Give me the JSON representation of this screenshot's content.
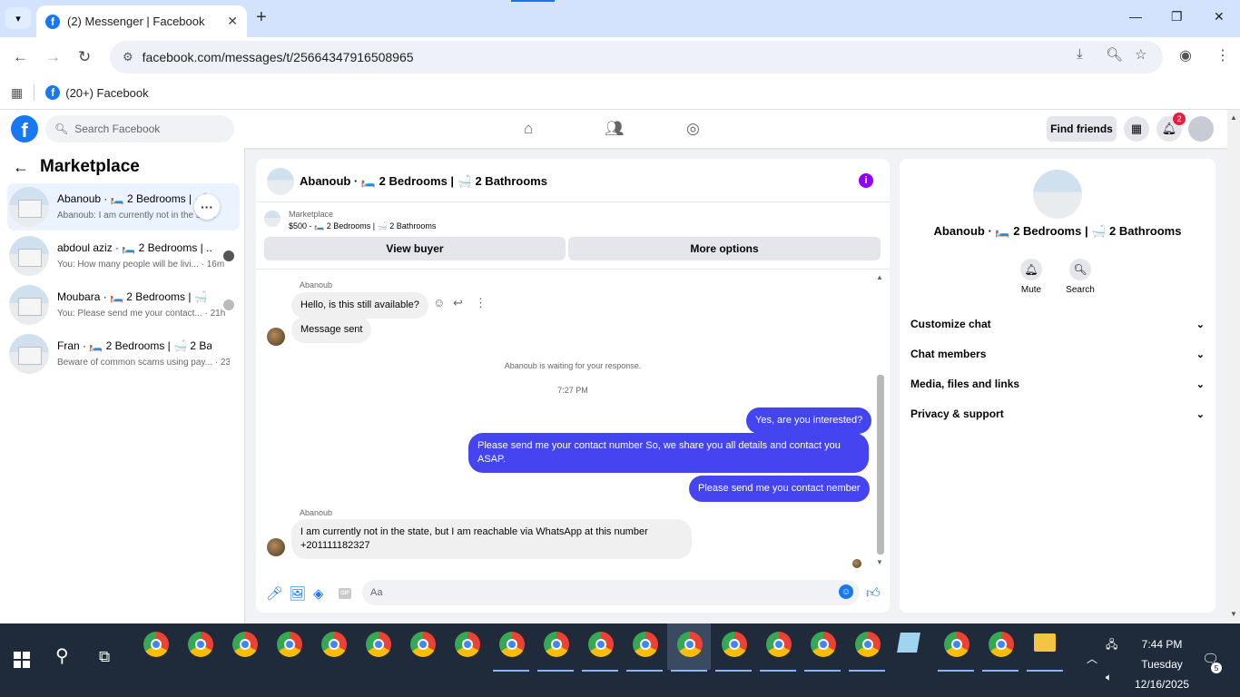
{
  "browser": {
    "tab_title": "(2) Messenger | Facebook",
    "url": "facebook.com/messages/t/25664347916508965",
    "bookmark_label": "(20+) Facebook"
  },
  "fb_header": {
    "search_placeholder": "Search Facebook",
    "find_friends_label": "Find friends",
    "notification_count": "2"
  },
  "sidebar": {
    "title": "Marketplace",
    "conversations": [
      {
        "name": "Abanoub · 🛏️ 2 Bedrooms | 🛁 2 B...",
        "snippet": "Abanoub: I am currently not in the state",
        "active": true
      },
      {
        "name": "abdoul aziz · 🛏️ 2 Bedrooms | ...",
        "snippet": "You: How many people will be livi... · 16m",
        "active": false
      },
      {
        "name": "Moubara · 🛏️ 2 Bedrooms | 🛁 ...",
        "snippet": "You: Please send me your contact... · 21h",
        "active": false
      },
      {
        "name": "Fran · 🛏️ 2 Bedrooms | 🛁 2 Bathr...",
        "snippet": "Beware of common scams using pay... · 23h",
        "active": false
      }
    ]
  },
  "chat": {
    "title": "Abanoub · 🛏️ 2 Bedrooms | 🛁 2 Bathrooms",
    "listing_category": "Marketplace",
    "listing_price": "$500 - 🛏️ 2 Bedrooms | 🛁 2 Bathrooms",
    "view_buyer_label": "View buyer",
    "more_options_label": "More options",
    "messages": {
      "sender1": "Abanoub",
      "m1": "Hello, is this still available?",
      "m2": "Message sent",
      "waiting": "Abanoub is waiting for your response.",
      "time": "7:27 PM",
      "m3": "Yes, are you interested?",
      "m4": "Please send me your contact number So, we share you all details and contact you ASAP.",
      "m5": "Please send me you contact nember",
      "sender2": "Abanoub",
      "m6": "I am currently not in the state, but I am reachable via WhatsApp at this number +201111182327"
    },
    "composer_placeholder": "Aa"
  },
  "info_panel": {
    "name": "Abanoub · 🛏️ 2 Bedrooms | 🛁 2 Bathrooms",
    "mute_label": "Mute",
    "search_label": "Search",
    "sections": [
      "Customize chat",
      "Chat members",
      "Media, files and links",
      "Privacy & support"
    ]
  },
  "taskbar": {
    "time": "7:44 PM",
    "day": "Tuesday",
    "date": "12/16/2025",
    "notification_count": "5"
  },
  "colors": {
    "fb_blue": "#1877f2",
    "outgoing_bubble": "#4444f0",
    "info_purple": "#9000ff",
    "taskbar": "#1f2a3a"
  }
}
